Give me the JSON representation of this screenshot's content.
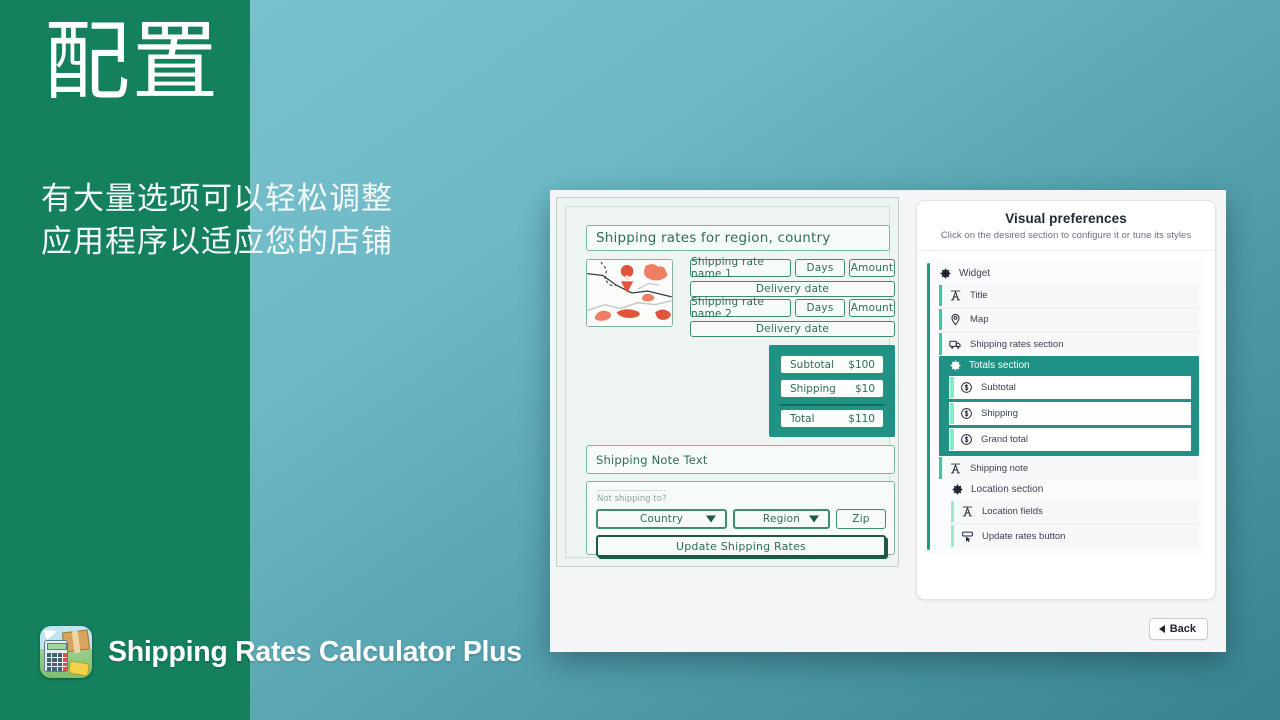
{
  "slide": {
    "headline": "配置",
    "subhead_lines": [
      "有大量选项可以轻松调整",
      "应用程序以适应您的店铺"
    ],
    "brand_title": "Shipping Rates Calculator Plus",
    "colors": {
      "left_slab": "#14805E",
      "gradient_start": "#7CC3D3",
      "gradient_end": "#36838F",
      "accent_teal": "#1F9185",
      "accent_green": "#18A07C",
      "sketch_ink": "#2F6E55"
    }
  },
  "preview": {
    "title": "Shipping rates for region, country",
    "map_icon": "map-pin-icon",
    "rates": [
      {
        "name": "Shipping rate name 1",
        "days": "Days",
        "amount": "Amount",
        "delivery": "Delivery date"
      },
      {
        "name": "Shipping rate name 2",
        "days": "Days",
        "amount": "Amount",
        "delivery": "Delivery date"
      }
    ],
    "totals": [
      {
        "label": "Subtotal",
        "value": "$100"
      },
      {
        "label": "Shipping",
        "value": "$10"
      },
      {
        "label": "Total",
        "value": "$110"
      }
    ],
    "note": "Shipping Note Text",
    "location": {
      "label": "Not shipping to?",
      "country": "Country",
      "region": "Region",
      "zip": "Zip",
      "update_button": "Update Shipping Rates"
    }
  },
  "prefs": {
    "title": "Visual preferences",
    "subtitle": "Click on the desired section to configure it or tune its styles",
    "groups": [
      {
        "label": "Widget",
        "icon": "gear-icon",
        "selected": false,
        "items": [
          {
            "label": "Title",
            "icon": "text-a-icon"
          },
          {
            "label": "Map",
            "icon": "map-pin-icon"
          },
          {
            "label": "Shipping rates section",
            "icon": "truck-icon"
          }
        ]
      },
      {
        "label": "Totals section",
        "icon": "gear-icon",
        "selected": true,
        "items": [
          {
            "label": "Subtotal",
            "icon": "dollar-circle-icon"
          },
          {
            "label": "Shipping",
            "icon": "dollar-circle-icon"
          },
          {
            "label": "Grand total",
            "icon": "dollar-circle-icon"
          }
        ]
      }
    ],
    "shipping_note": {
      "label": "Shipping note",
      "icon": "text-a-icon"
    },
    "location_group": {
      "label": "Location section",
      "icon": "gear-icon",
      "items": [
        {
          "label": "Location fields",
          "icon": "text-a-icon"
        },
        {
          "label": "Update rates button",
          "icon": "click-button-icon"
        }
      ]
    },
    "back_button": "Back"
  }
}
